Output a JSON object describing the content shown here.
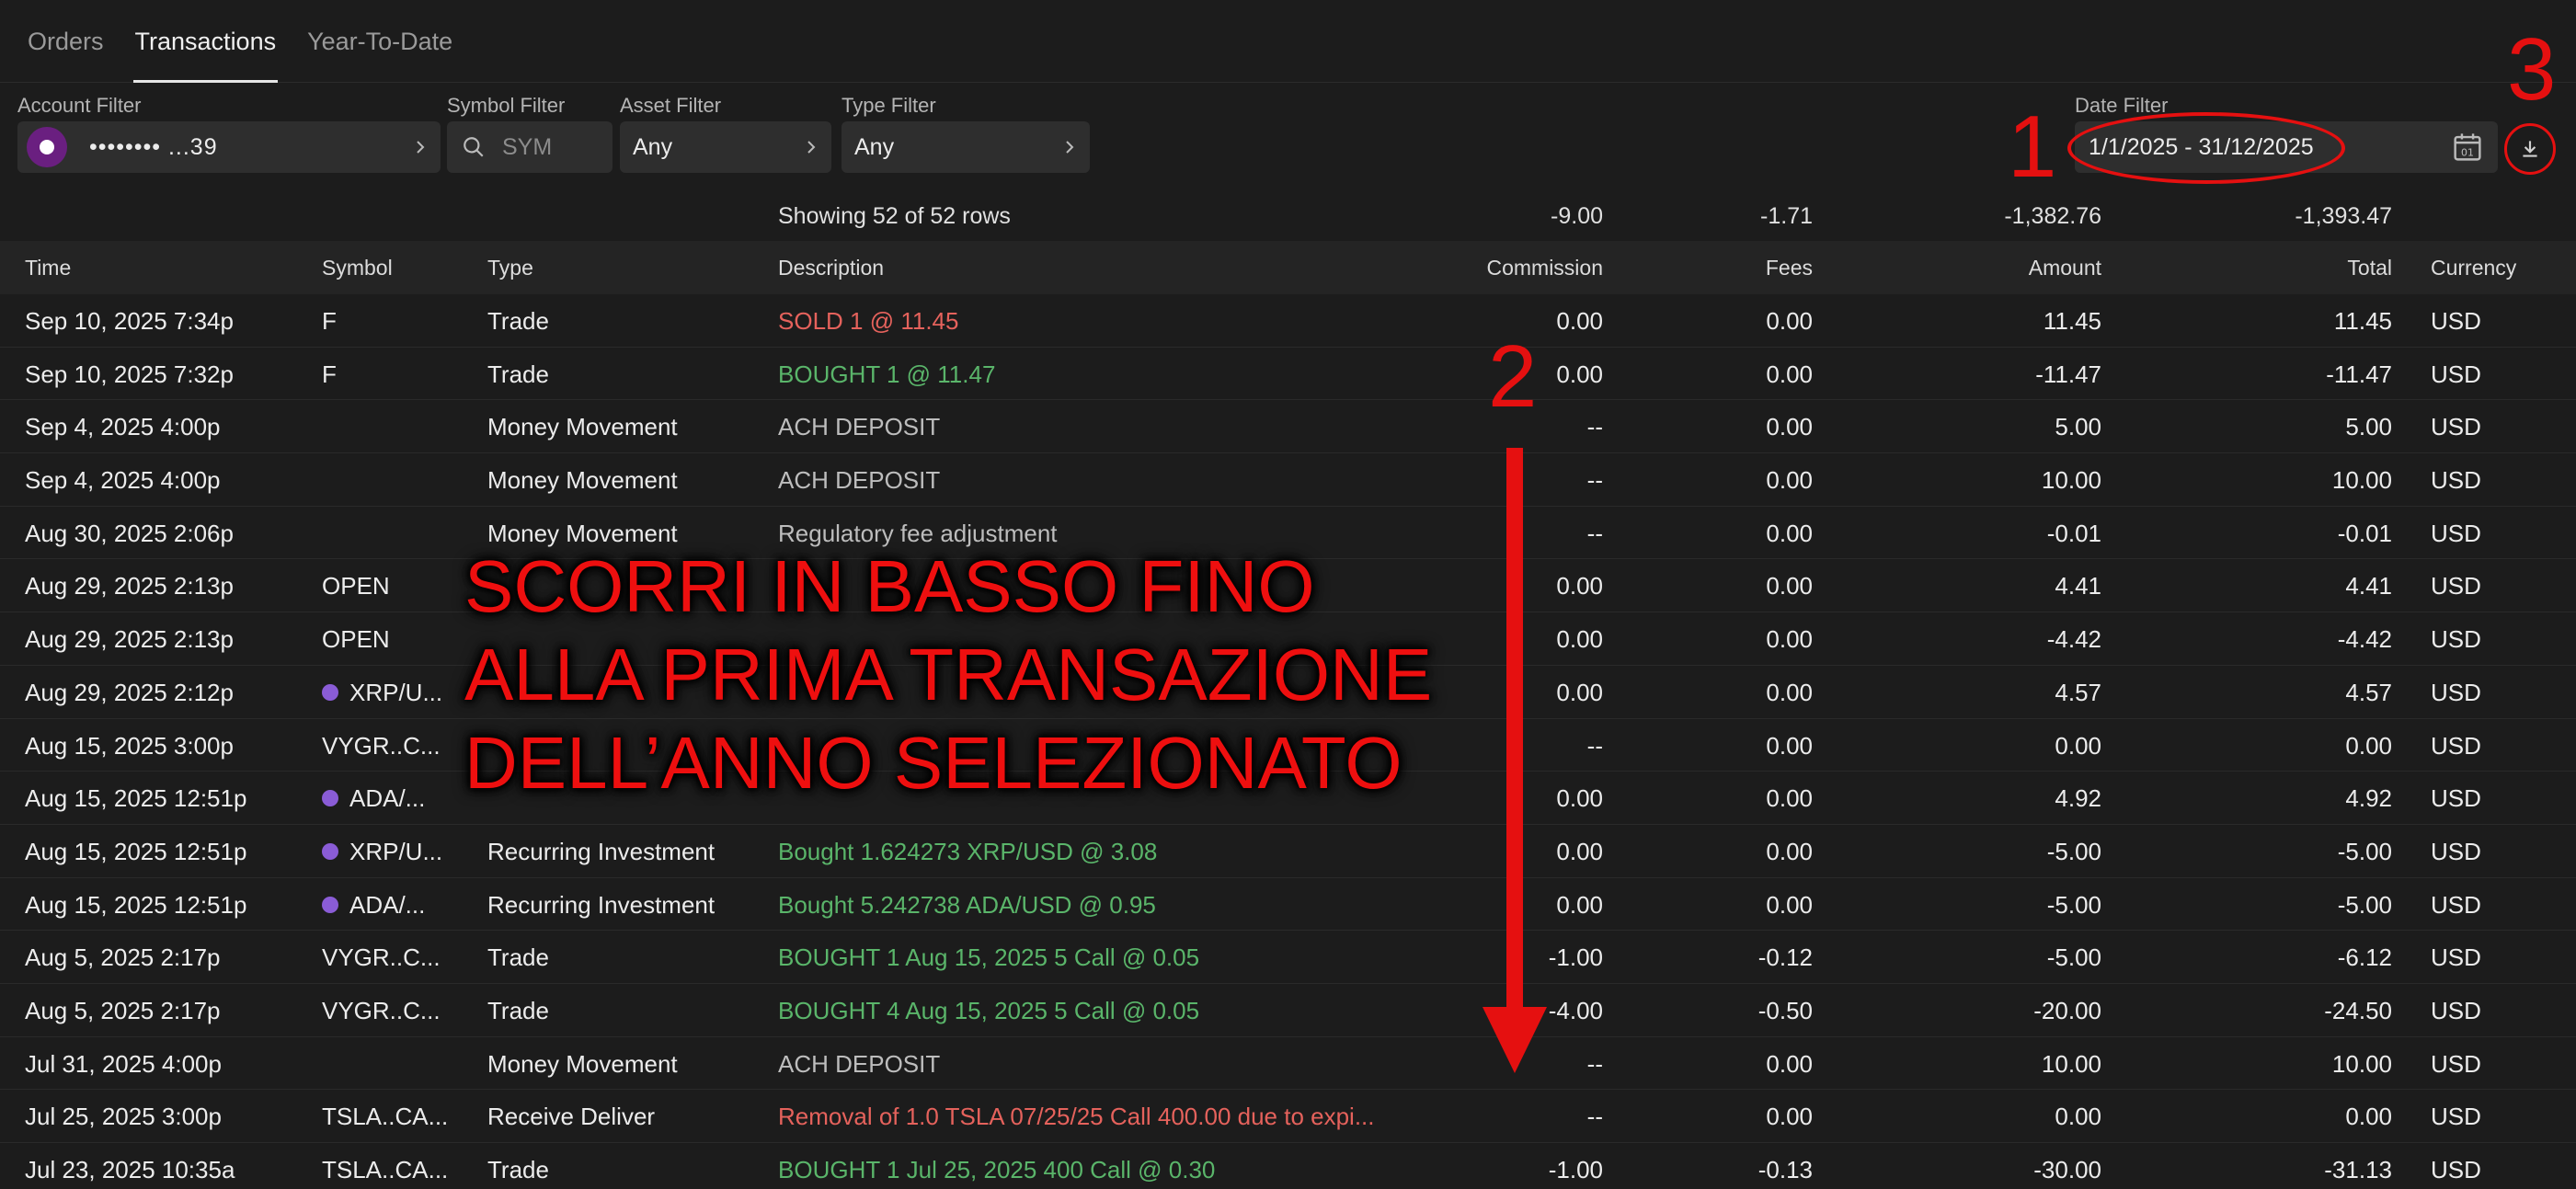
{
  "tabs": [
    "Orders",
    "Transactions",
    "Year-To-Date"
  ],
  "filters": {
    "account_label": "Account Filter",
    "account_value": "•••••••• ...39",
    "symbol_label": "Symbol Filter",
    "symbol_placeholder": "SYM",
    "asset_label": "Asset Filter",
    "asset_value": "Any",
    "type_label": "Type Filter",
    "type_value": "Any",
    "date_label": "Date Filter",
    "date_value": "1/1/2025 - 31/12/2025"
  },
  "summary": {
    "rows_text": "Showing 52 of 52 rows",
    "commission": "-9.00",
    "fees": "-1.71",
    "amount": "-1,382.76",
    "total": "-1,393.47"
  },
  "columns": [
    "Time",
    "Symbol",
    "Type",
    "Description",
    "Commission",
    "Fees",
    "Amount",
    "Total",
    "Currency"
  ],
  "rows": [
    {
      "time": "Sep 10, 2025 7:34p",
      "symbol": "F",
      "icon": false,
      "type": "Trade",
      "desc": "SOLD 1 @ 11.45",
      "dcolor": "red",
      "commission": "0.00",
      "fees": "0.00",
      "amount": "11.45",
      "total": "11.45",
      "currency": "USD"
    },
    {
      "time": "Sep 10, 2025 7:32p",
      "symbol": "F",
      "icon": false,
      "type": "Trade",
      "desc": "BOUGHT 1 @ 11.47",
      "dcolor": "green",
      "commission": "0.00",
      "fees": "0.00",
      "amount": "-11.47",
      "total": "-11.47",
      "currency": "USD"
    },
    {
      "time": "Sep 4, 2025 4:00p",
      "symbol": "",
      "icon": false,
      "type": "Money Movement",
      "desc": "ACH DEPOSIT",
      "dcolor": "gray",
      "commission": "--",
      "fees": "0.00",
      "amount": "5.00",
      "total": "5.00",
      "currency": "USD"
    },
    {
      "time": "Sep 4, 2025 4:00p",
      "symbol": "",
      "icon": false,
      "type": "Money Movement",
      "desc": "ACH DEPOSIT",
      "dcolor": "gray",
      "commission": "--",
      "fees": "0.00",
      "amount": "10.00",
      "total": "10.00",
      "currency": "USD"
    },
    {
      "time": "Aug 30, 2025 2:06p",
      "symbol": "",
      "icon": false,
      "type": "Money Movement",
      "desc": "Regulatory fee adjustment",
      "dcolor": "gray",
      "commission": "--",
      "fees": "0.00",
      "amount": "-0.01",
      "total": "-0.01",
      "currency": "USD"
    },
    {
      "time": "Aug 29, 2025 2:13p",
      "symbol": "OPEN",
      "icon": false,
      "type": "",
      "desc": "",
      "dcolor": "gray",
      "commission": "0.00",
      "fees": "0.00",
      "amount": "4.41",
      "total": "4.41",
      "currency": "USD"
    },
    {
      "time": "Aug 29, 2025 2:13p",
      "symbol": "OPEN",
      "icon": false,
      "type": "",
      "desc": "",
      "dcolor": "gray",
      "commission": "0.00",
      "fees": "0.00",
      "amount": "-4.42",
      "total": "-4.42",
      "currency": "USD"
    },
    {
      "time": "Aug 29, 2025 2:12p",
      "symbol": "XRP/U...",
      "icon": true,
      "type": "",
      "desc": "",
      "dcolor": "gray",
      "commission": "0.00",
      "fees": "0.00",
      "amount": "4.57",
      "total": "4.57",
      "currency": "USD"
    },
    {
      "time": "Aug 15, 2025 3:00p",
      "symbol": "VYGR..C...",
      "icon": false,
      "type": "",
      "desc": "",
      "dcolor": "gray",
      "commission": "--",
      "fees": "0.00",
      "amount": "0.00",
      "total": "0.00",
      "currency": "USD"
    },
    {
      "time": "Aug 15, 2025 12:51p",
      "symbol": "ADA/...",
      "icon": true,
      "type": "",
      "desc": "",
      "dcolor": "red",
      "commission": "0.00",
      "fees": "0.00",
      "amount": "4.92",
      "total": "4.92",
      "currency": "USD"
    },
    {
      "time": "Aug 15, 2025 12:51p",
      "symbol": "XRP/U...",
      "icon": true,
      "type": "Recurring Investment",
      "desc": "Bought 1.624273 XRP/USD @ 3.08",
      "dcolor": "green",
      "commission": "0.00",
      "fees": "0.00",
      "amount": "-5.00",
      "total": "-5.00",
      "currency": "USD"
    },
    {
      "time": "Aug 15, 2025 12:51p",
      "symbol": "ADA/...",
      "icon": true,
      "type": "Recurring Investment",
      "desc": "Bought 5.242738 ADA/USD @ 0.95",
      "dcolor": "green",
      "commission": "0.00",
      "fees": "0.00",
      "amount": "-5.00",
      "total": "-5.00",
      "currency": "USD"
    },
    {
      "time": "Aug 5, 2025 2:17p",
      "symbol": "VYGR..C...",
      "icon": false,
      "type": "Trade",
      "desc": "BOUGHT 1 Aug 15, 2025 5 Call @ 0.05",
      "dcolor": "green",
      "commission": "-1.00",
      "fees": "-0.12",
      "amount": "-5.00",
      "total": "-6.12",
      "currency": "USD"
    },
    {
      "time": "Aug 5, 2025 2:17p",
      "symbol": "VYGR..C...",
      "icon": false,
      "type": "Trade",
      "desc": "BOUGHT 4 Aug 15, 2025 5 Call @ 0.05",
      "dcolor": "green",
      "commission": "-4.00",
      "fees": "-0.50",
      "amount": "-20.00",
      "total": "-24.50",
      "currency": "USD"
    },
    {
      "time": "Jul 31, 2025 4:00p",
      "symbol": "",
      "icon": false,
      "type": "Money Movement",
      "desc": "ACH DEPOSIT",
      "dcolor": "gray",
      "commission": "--",
      "fees": "0.00",
      "amount": "10.00",
      "total": "10.00",
      "currency": "USD"
    },
    {
      "time": "Jul 25, 2025 3:00p",
      "symbol": "TSLA..CA...",
      "icon": false,
      "type": "Receive Deliver",
      "desc": "Removal of 1.0 TSLA 07/25/25 Call 400.00 due to expi...",
      "dcolor": "red",
      "commission": "--",
      "fees": "0.00",
      "amount": "0.00",
      "total": "0.00",
      "currency": "USD"
    },
    {
      "time": "Jul 23, 2025 10:35a",
      "symbol": "TSLA..CA...",
      "icon": false,
      "type": "Trade",
      "desc": "BOUGHT 1 Jul 25, 2025 400 Call @ 0.30",
      "dcolor": "green",
      "commission": "-1.00",
      "fees": "-0.13",
      "amount": "-30.00",
      "total": "-31.13",
      "currency": "USD"
    }
  ],
  "annotations": {
    "step1": "1",
    "step2": "2",
    "step3": "3",
    "overlay_line1": "SCORRI IN BASSO FINO",
    "overlay_line2": "ALLA PRIMA TRANSAZIONE",
    "overlay_line3": "DELL’ANNO SELEZIONATO",
    "color": "#e51010"
  },
  "colors": {
    "background": "#1c1c1c",
    "positive_desc": "#5ab56a",
    "negative_desc": "#e5625c",
    "account_avatar": "#6a1f80",
    "crypto_icon": "#8a5cd6"
  }
}
